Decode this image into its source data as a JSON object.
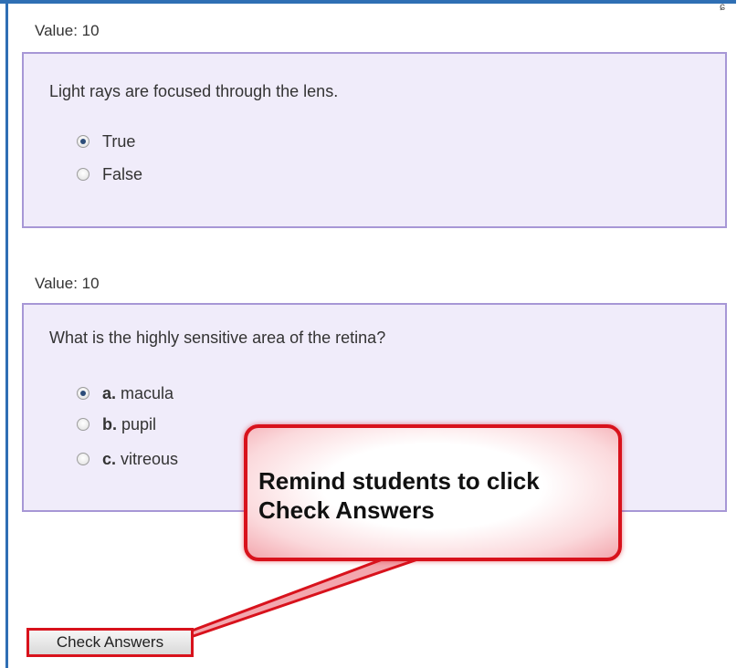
{
  "corner_mark": "ɕ",
  "questions": [
    {
      "value_label": "Value: 10",
      "text": "Light rays are focused through the lens.",
      "options": [
        {
          "letter": "",
          "label": "True",
          "checked": true
        },
        {
          "letter": "",
          "label": "False",
          "checked": false
        }
      ]
    },
    {
      "value_label": "Value: 10",
      "text": "What is the highly sensitive area of the retina?",
      "options": [
        {
          "letter": "a.",
          "label": "macula",
          "checked": true
        },
        {
          "letter": "b.",
          "label": "pupil",
          "checked": false
        },
        {
          "letter": "c.",
          "label": "vitreous",
          "checked": false
        }
      ]
    }
  ],
  "callout": {
    "text": "Remind students to click\nCheck Answers"
  },
  "check_button": {
    "label": "Check Answers"
  },
  "colors": {
    "frame": "#2f6fb4",
    "question_box_bg": "#f0ecfa",
    "question_box_border": "#a797d6",
    "callout_border": "#d8121c"
  }
}
